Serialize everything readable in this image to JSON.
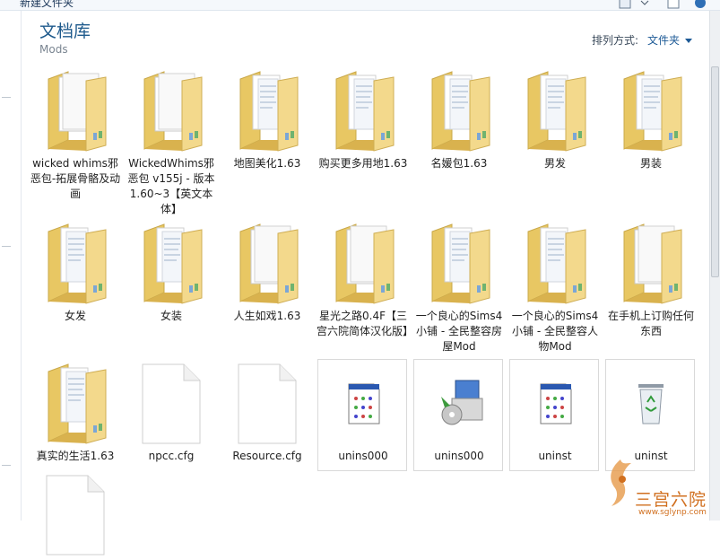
{
  "toolbar": {
    "new_folder_label": "新建文件夹"
  },
  "library": {
    "title": "文档库",
    "subtitle": "Mods"
  },
  "arrange": {
    "label": "排列方式:",
    "value": "文件夹"
  },
  "items": [
    {
      "label": "wicked whims邪恶包-拓展骨骼及动画",
      "icon": "folder-white-icon"
    },
    {
      "label": "WickedWhims邪恶包 v155j - 版本1.60~3【英文本体】",
      "icon": "folder-white-icon"
    },
    {
      "label": "地图美化1.63",
      "icon": "folder-icon"
    },
    {
      "label": "购买更多用地1.63",
      "icon": "folder-icon"
    },
    {
      "label": "名媛包1.63",
      "icon": "folder-icon"
    },
    {
      "label": "男发",
      "icon": "folder-icon"
    },
    {
      "label": "男装",
      "icon": "folder-icon"
    },
    {
      "label": "女发",
      "icon": "folder-icon"
    },
    {
      "label": "女装",
      "icon": "folder-icon"
    },
    {
      "label": "人生如戏1.63",
      "icon": "folder-white-icon"
    },
    {
      "label": "星光之路0.4F【三宫六院简体汉化版】",
      "icon": "folder-white-icon"
    },
    {
      "label": "一个良心的Sims4小铺 - 全民整容房屋Mod",
      "icon": "folder-icon"
    },
    {
      "label": "一个良心的Sims4小铺 - 全民整容人物Mod",
      "icon": "folder-icon"
    },
    {
      "label": "在手机上订购任何东西",
      "icon": "folder-white-icon"
    },
    {
      "label": "真实的生活1.63",
      "icon": "folder-icon"
    },
    {
      "label": "npcc.cfg",
      "icon": "blank-file-icon"
    },
    {
      "label": "Resource.cfg",
      "icon": "blank-file-icon"
    },
    {
      "label": "unins000",
      "icon": "dat-file-icon"
    },
    {
      "label": "unins000",
      "icon": "installer-icon"
    },
    {
      "label": "uninst",
      "icon": "dat-file-icon"
    },
    {
      "label": "uninst",
      "icon": "recycle-bin-icon"
    },
    {
      "label": "",
      "icon": "blank-file-icon"
    }
  ],
  "watermark": {
    "text": "三宫六院",
    "url": "www.sglynp.com"
  }
}
